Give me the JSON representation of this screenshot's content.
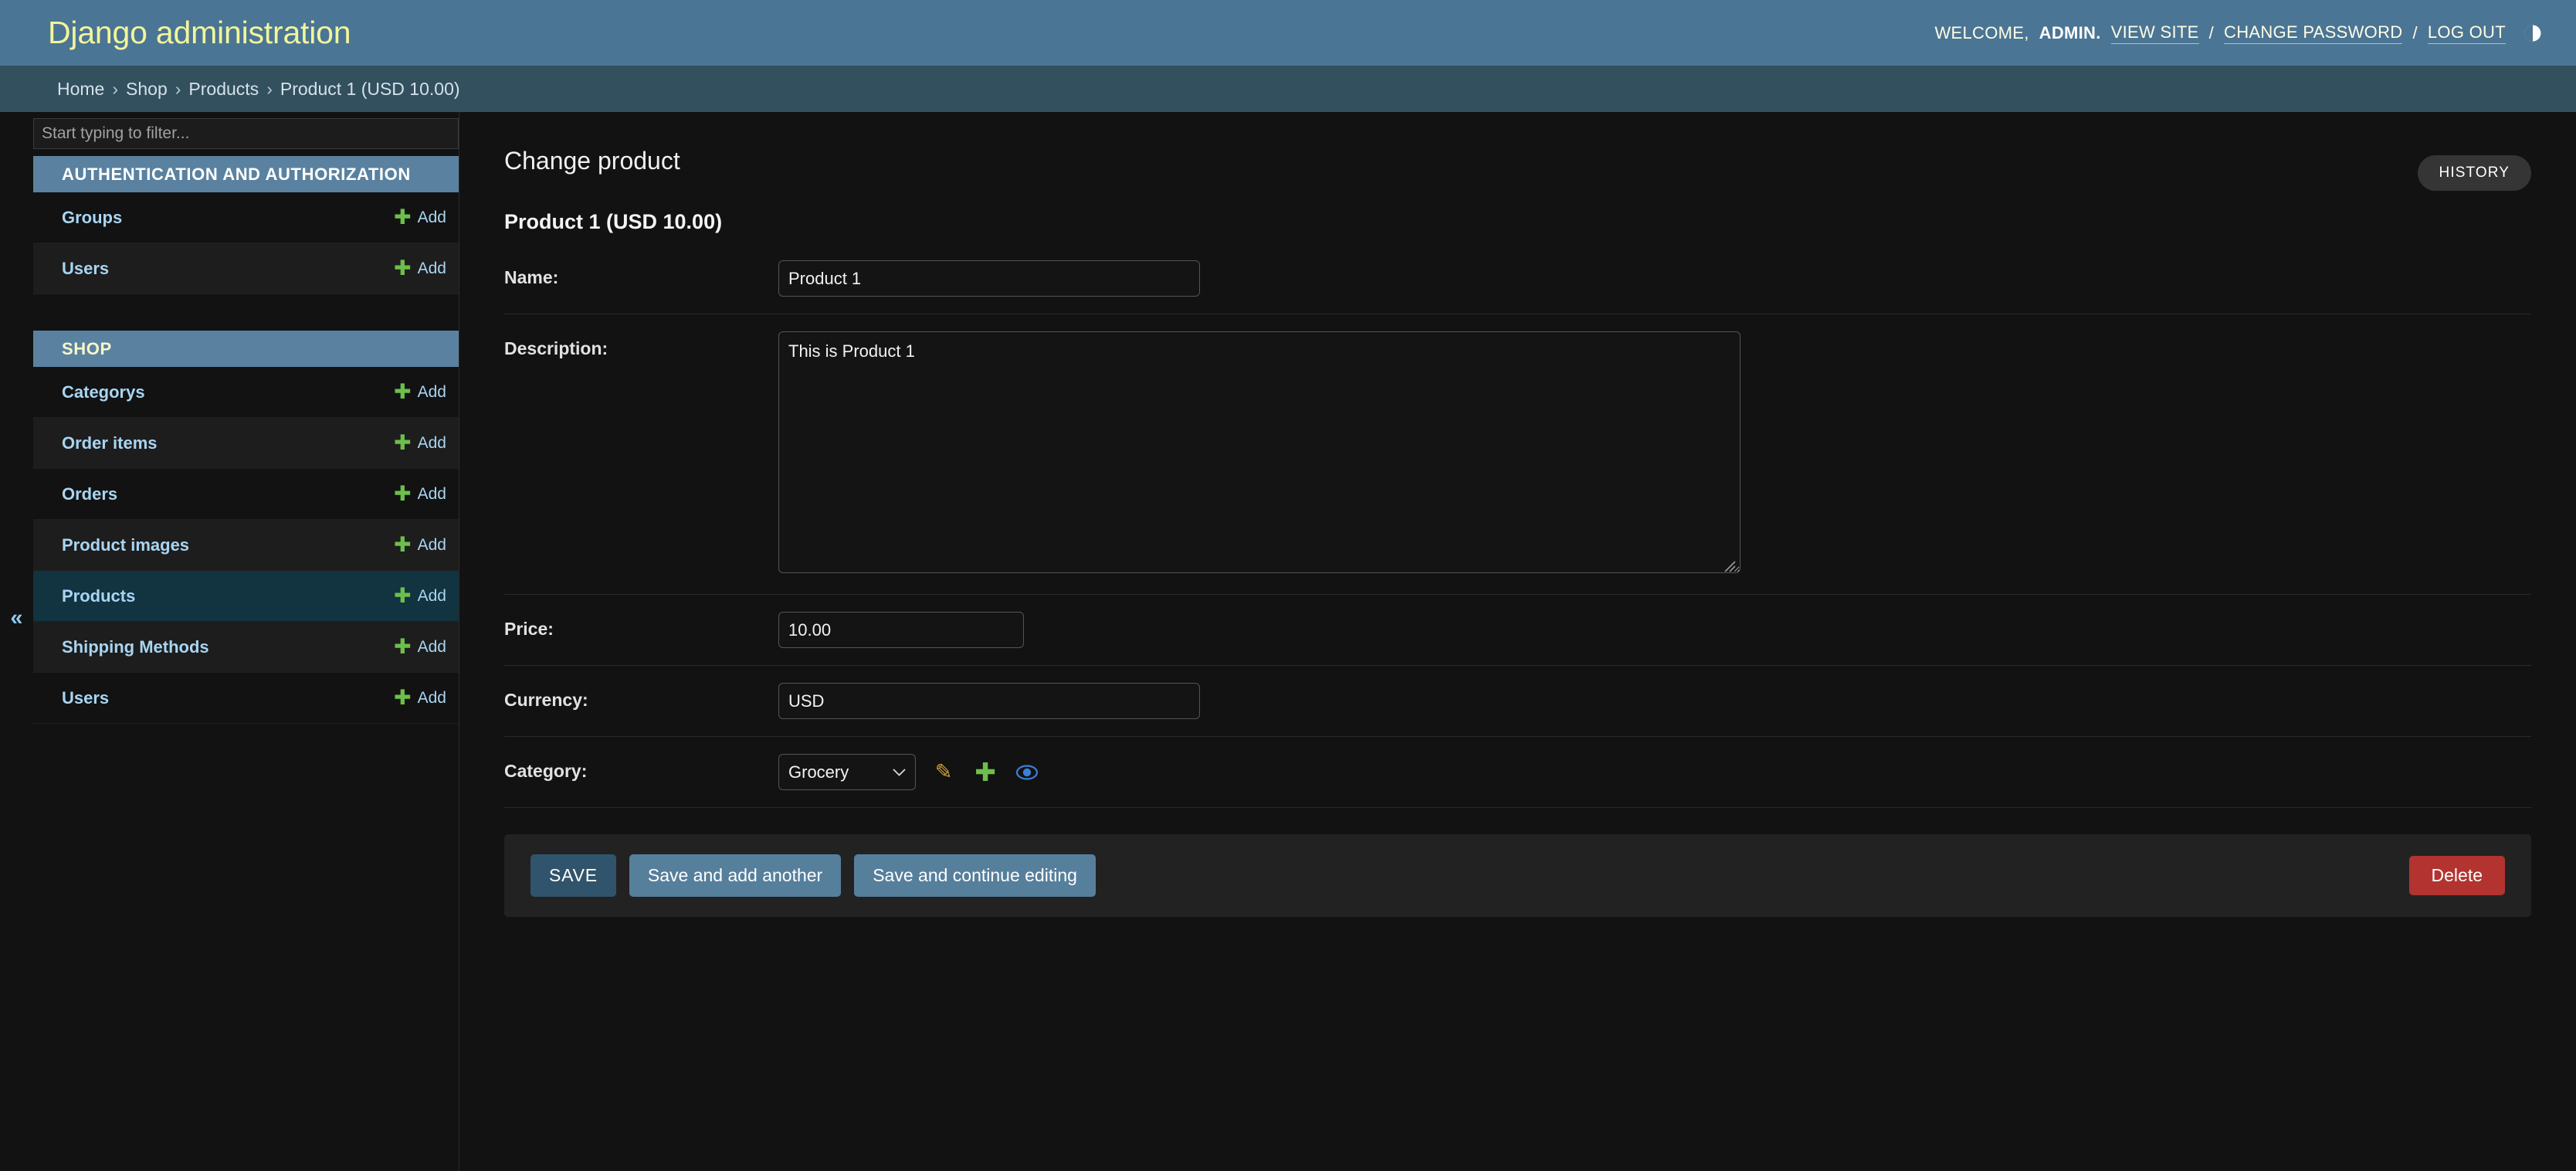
{
  "header": {
    "site_name": "Django administration",
    "welcome_text": "WELCOME,",
    "username": "ADMIN.",
    "view_site": "VIEW SITE",
    "sep1": "/",
    "change_password": "CHANGE PASSWORD",
    "sep2": "/",
    "log_out": "LOG OUT",
    "theme_toggle_icon": "contrast-circle-icon",
    "bg_color": "#4b7594",
    "brand_color": "#f2f59b"
  },
  "breadcrumbs": {
    "items": [
      {
        "label": "Home",
        "link": true
      },
      {
        "label": "Shop",
        "link": true
      },
      {
        "label": "Products",
        "link": true
      },
      {
        "label": "Product 1 (USD 10.00)",
        "link": false
      }
    ],
    "separator": "›",
    "bg_color": "#33505f"
  },
  "sidebar": {
    "filter_placeholder": "Start typing to filter...",
    "filter_value": "",
    "collapse_icon": "chevron-double-left-icon",
    "add_label": "Add",
    "modules": [
      {
        "caption": "AUTHENTICATION AND AUTHORIZATION",
        "caption_color": "#ffffff",
        "models": [
          {
            "name": "Groups",
            "add": "Add",
            "current": false
          },
          {
            "name": "Users",
            "add": "Add",
            "current": false
          }
        ]
      },
      {
        "caption": "SHOP",
        "caption_color": "#f7f7c9",
        "models": [
          {
            "name": "Categorys",
            "add": "Add",
            "current": false
          },
          {
            "name": "Order items",
            "add": "Add",
            "current": false
          },
          {
            "name": "Orders",
            "add": "Add",
            "current": false
          },
          {
            "name": "Product images",
            "add": "Add",
            "current": false
          },
          {
            "name": "Products",
            "add": "Add",
            "current": true
          },
          {
            "name": "Shipping Methods",
            "add": "Add",
            "current": false
          },
          {
            "name": "Users",
            "add": "Add",
            "current": false
          }
        ]
      }
    ],
    "highlight_color": "#123340",
    "caption_bg": "#5a82a0"
  },
  "content": {
    "page_title": "Change product",
    "object_name": "Product 1 (USD 10.00)",
    "history_label": "HISTORY",
    "form": {
      "name": {
        "label": "Name:",
        "value": "Product 1"
      },
      "description": {
        "label": "Description:",
        "value": "This is Product 1"
      },
      "price": {
        "label": "Price:",
        "value": "10.00"
      },
      "currency": {
        "label": "Currency:",
        "value": "USD"
      },
      "category": {
        "label": "Category:",
        "value": "Grocery",
        "options": [
          "Grocery"
        ],
        "edit_icon": "pencil-icon",
        "add_icon": "plus-icon",
        "view_icon": "eye-icon"
      }
    },
    "submit_row": {
      "save": "SAVE",
      "save_and_add_another": "Save and add another",
      "save_and_continue": "Save and continue editing",
      "delete": "Delete",
      "save_color": "#30546b",
      "save_alt_color": "#567f9c",
      "delete_color": "#b23330"
    }
  }
}
